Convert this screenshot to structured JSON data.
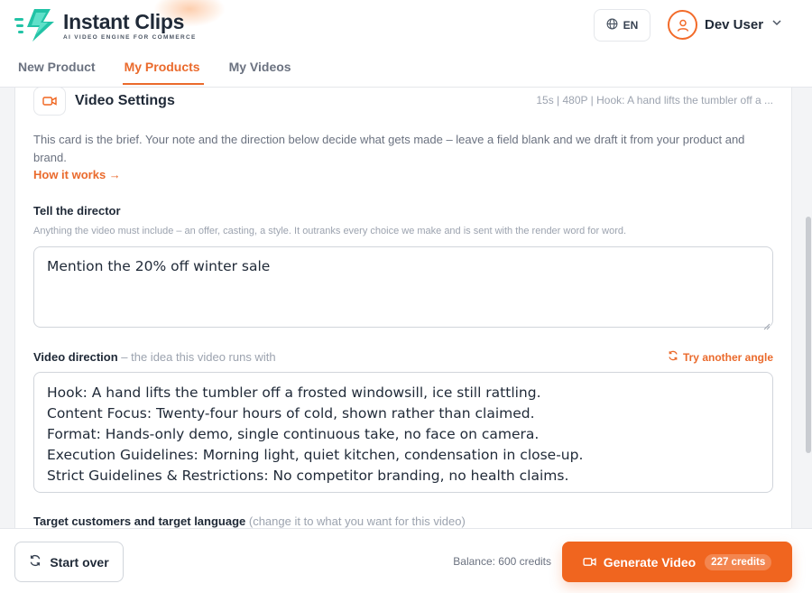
{
  "brand": {
    "name": "Instant Clips",
    "tagline": "AI VIDEO ENGINE FOR COMMERCE"
  },
  "header": {
    "language": "EN",
    "user_name": "Dev User"
  },
  "tabs": [
    {
      "label": "New Product"
    },
    {
      "label": "My Products"
    },
    {
      "label": "My Videos"
    }
  ],
  "card": {
    "title": "Video Settings",
    "summary": "15s | 480P | Hook: A hand lifts the tumbler off a ...",
    "intro": "This card is the brief. Your note and the direction below decide what gets made – leave a field blank and we draft it from your product and brand.",
    "how_it_works": "How it works →"
  },
  "director": {
    "label": "Tell the director",
    "hint": "Anything the video must include – an offer, casting, a style. It outranks every choice we make and is sent with the render word for word.",
    "value": "Mention the 20% off winter sale"
  },
  "direction": {
    "label": "Video direction",
    "sublabel": " – the idea this video runs with",
    "try_label": "Try another angle",
    "lines": [
      "Hook: A hand lifts the tumbler off a frosted windowsill, ice still rattling.",
      "Content Focus: Twenty-four hours of cold, shown rather than claimed.",
      "Format: Hands-only demo, single continuous take, no face on camera.",
      "Execution Guidelines: Morning light, quiet kitchen, condensation in close-up.",
      "Strict Guidelines & Restrictions: No competitor branding, no health claims."
    ]
  },
  "target": {
    "label": "Target customers and target language",
    "sublabel": " (change it to what you want for this video)"
  },
  "footer": {
    "start_over": "Start over",
    "balance": "Balance: 600 credits",
    "generate": "Generate Video",
    "generate_credits": "227 credits"
  },
  "colors": {
    "accent": "#f0651f",
    "accent_text": "#ea6a2c",
    "logo_teal": "#22c3a6"
  },
  "icons": [
    "logo-bolt-icon",
    "globe-icon",
    "user-icon",
    "chevron-down-icon",
    "video-camera-icon",
    "refresh-icon"
  ]
}
